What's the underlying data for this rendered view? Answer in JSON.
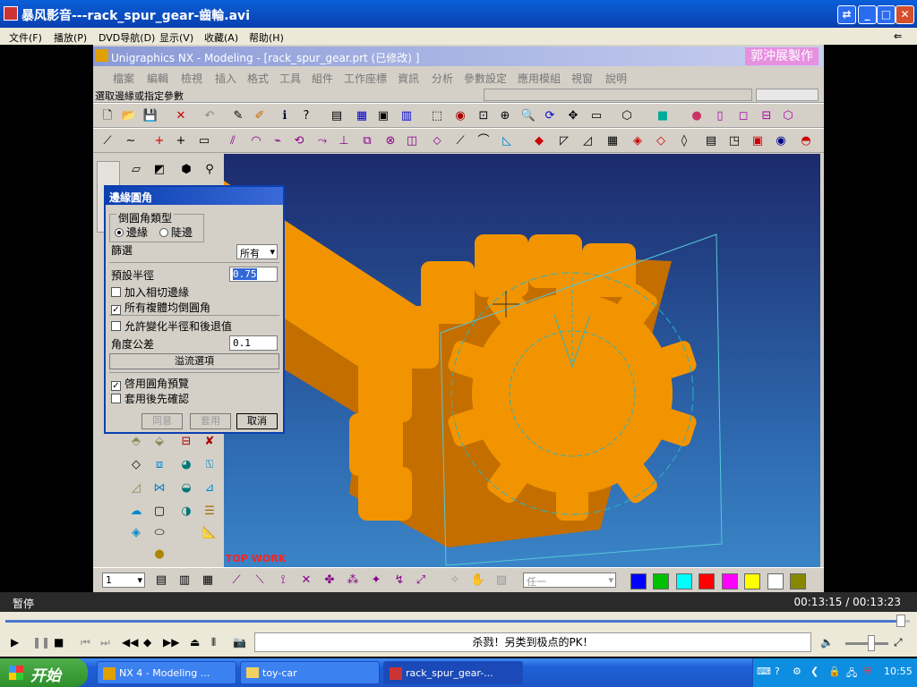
{
  "player": {
    "title": "暴风影音---rack_spur_gear-齒輪.avi",
    "menu": [
      "文件(F)",
      "播放(P)",
      "DVD导航(D)",
      "显示(V)",
      "收藏(A)",
      "帮助(H)"
    ],
    "status_left": "暂停",
    "time": "00:13:15 / 00:13:23",
    "marquee": "杀戮！另类到极点的PK！",
    "progress": 0.99,
    "volume": 0.6
  },
  "nx": {
    "title": "Unigraphics NX - Modeling - [rack_spur_gear.prt (已修改) ]",
    "signature": "郭沖展製作",
    "menu": [
      "檔案",
      "編輯",
      "檢視",
      "插入",
      "格式",
      "工具",
      "組件",
      "工作座標",
      "資訊",
      "分析",
      "參數設定",
      "應用模組",
      "視窗",
      "說明"
    ],
    "status": "選取邊緣或指定參數",
    "watermark": "TOP WORK",
    "layer_value": "1",
    "select_filter": "任一"
  },
  "dialog": {
    "title": "邊緣圓角",
    "group_label": "倒圓角類型",
    "radio_edge": "邊緣",
    "radio_steep": "陡邊",
    "filter_label": "篩選",
    "filter_value": "所有",
    "radius_label": "預設半徑",
    "radius_value": "0.75",
    "add_tangent": "加入相切邊緣",
    "all_bodies": "所有複體均倒圓角",
    "allow_vary": "允許變化半徑和後退值",
    "angle_tol_label": "角度公差",
    "angle_tol_value": "0.1",
    "overflow_btn": "溢流選項",
    "preview": "啓用圓角預覽",
    "confirm": "套用後先確認",
    "ok": "同意",
    "apply": "套用",
    "cancel": "取消"
  },
  "taskbar": {
    "start": "开始",
    "tasks": [
      "NX 4 - Modeling ...",
      "toy-car",
      "rack_spur_gear-..."
    ],
    "clock": "10:55"
  },
  "colors": {
    "gear": "#f29400",
    "gear_shadow": "#c46e00",
    "swatches": [
      "#0000ff",
      "#00c000",
      "#00ffff",
      "#ff0000",
      "#ff00ff",
      "#ffff00",
      "#ffffff",
      "#888800"
    ]
  }
}
